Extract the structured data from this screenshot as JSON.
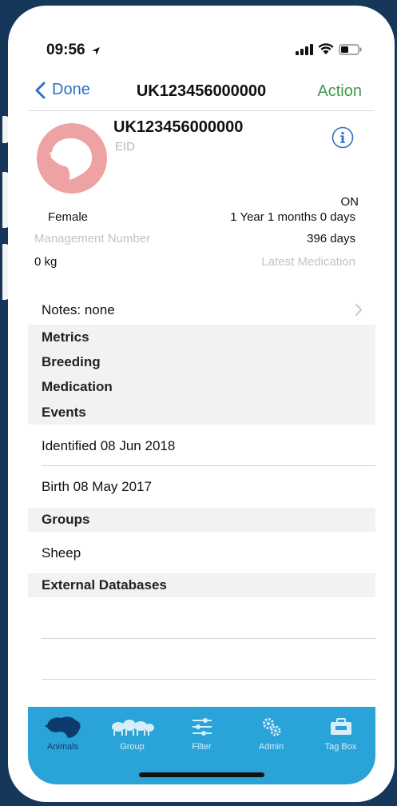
{
  "status": {
    "time": "09:56"
  },
  "nav": {
    "back_label": "Done",
    "title": "UK123456000000",
    "action_label": "Action"
  },
  "animal": {
    "id": "UK123456000000",
    "id_type": "EID",
    "status": "ON",
    "sex": "Female",
    "age": "1 Year 1 months 0 days",
    "management_number_label": "Management Number",
    "days": "396 days",
    "weight": "0 kg",
    "latest_medication_label": "Latest Medication"
  },
  "notes": {
    "label": "Notes: none"
  },
  "sections": {
    "metrics": "Metrics",
    "breeding": "Breeding",
    "medication": "Medication",
    "events": "Events",
    "groups": "Groups",
    "external": "External Databases"
  },
  "events": [
    "Identified 08 Jun 2018",
    "Birth 08 May 2017"
  ],
  "groups": [
    "Sheep"
  ],
  "tabs": [
    {
      "label": "Animals",
      "icon": "animals-icon",
      "active": true
    },
    {
      "label": "Group",
      "icon": "group-icon",
      "active": false
    },
    {
      "label": "Filter",
      "icon": "filter-icon",
      "active": false
    },
    {
      "label": "Admin",
      "icon": "admin-gears-icon",
      "active": false
    },
    {
      "label": "Tag Box",
      "icon": "tag-box-icon",
      "active": false
    }
  ],
  "colors": {
    "accent_blue": "#2e6fc2",
    "action_green": "#3c9a4a",
    "tabbar_blue": "#2aa3d8",
    "avatar_pink": "#eea2a4",
    "background_navy": "#16375a"
  }
}
